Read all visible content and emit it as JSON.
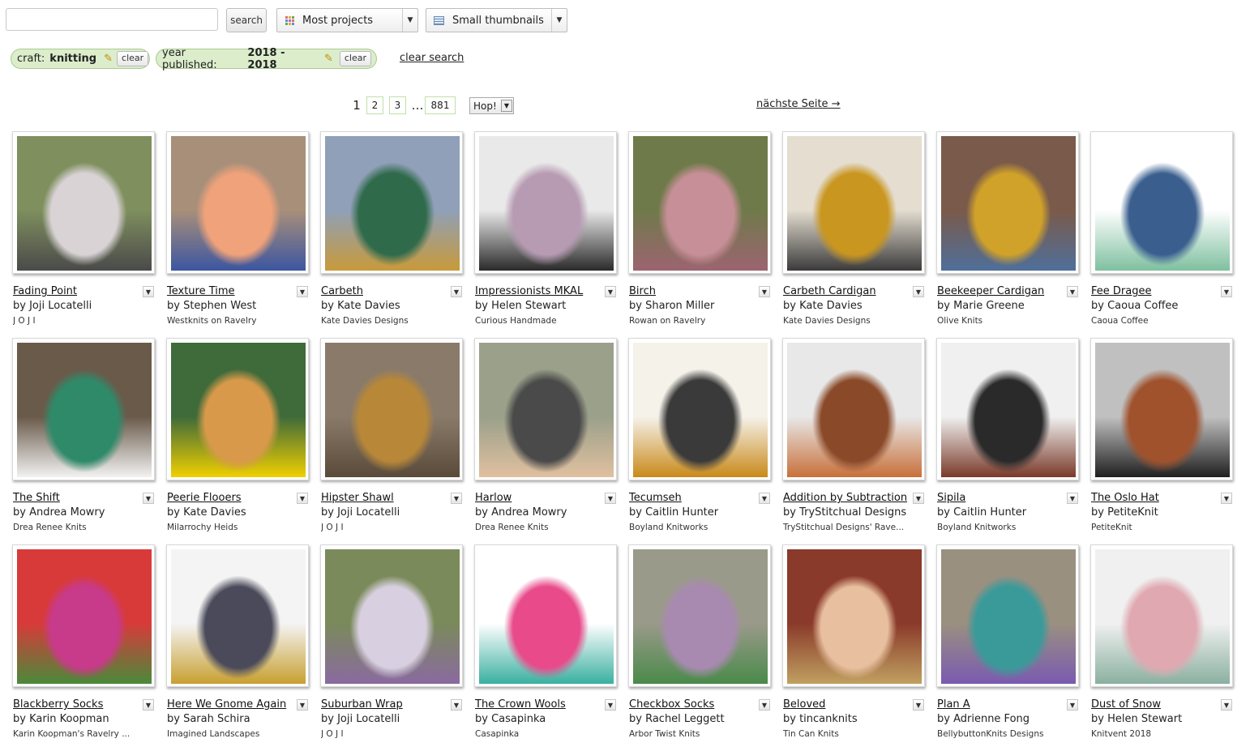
{
  "search": {
    "value": "",
    "button_label": "search"
  },
  "sort_dropdown": {
    "selected": "Most projects"
  },
  "view_dropdown": {
    "selected": "Small thumbnails"
  },
  "filters": [
    {
      "label": "craft:",
      "value": "knitting",
      "clear_label": "clear"
    },
    {
      "label": "year published:",
      "value": "2018 - 2018",
      "clear_label": "clear"
    }
  ],
  "clear_search_label": "clear search",
  "pagination": {
    "current": "1",
    "pages": [
      "2",
      "3"
    ],
    "ellipsis": "…",
    "last": "881",
    "hop_label": "Hop!",
    "next_label": "nächste Seite →"
  },
  "patterns": [
    {
      "name": "Fading Point",
      "author": "by Joji Locatelli",
      "source": "J O J I"
    },
    {
      "name": "Texture Time",
      "author": "by Stephen West",
      "source": "Westknits on Ravelry"
    },
    {
      "name": "Carbeth",
      "author": "by Kate Davies",
      "source": "Kate Davies Designs"
    },
    {
      "name": "Impressionists MKAL",
      "author": "by Helen Stewart",
      "source": "Curious Handmade"
    },
    {
      "name": "Birch",
      "author": "by Sharon Miller",
      "source": "Rowan on Ravelry"
    },
    {
      "name": "Carbeth Cardigan",
      "author": "by Kate Davies",
      "source": "Kate Davies Designs"
    },
    {
      "name": "Beekeeper Cardigan",
      "author": "by Marie Greene",
      "source": "Olive Knits"
    },
    {
      "name": "Fee Dragee",
      "author": "by Caoua Coffee",
      "source": "Caoua Coffee"
    },
    {
      "name": "The Shift",
      "author": "by Andrea Mowry",
      "source": "Drea Renee Knits"
    },
    {
      "name": "Peerie Flooers",
      "author": "by Kate Davies",
      "source": "Milarrochy Heids"
    },
    {
      "name": "Hipster Shawl",
      "author": "by Joji Locatelli",
      "source": "J O J I"
    },
    {
      "name": "Harlow",
      "author": "by Andrea Mowry",
      "source": "Drea Renee Knits"
    },
    {
      "name": "Tecumseh",
      "author": "by Caitlin Hunter",
      "source": "Boyland Knitworks"
    },
    {
      "name": "Addition by Subtraction",
      "author": "by TryStitchual Designs",
      "source": "TryStitchual Designs' Rave..."
    },
    {
      "name": "Sipila",
      "author": "by Caitlin Hunter",
      "source": "Boyland Knitworks"
    },
    {
      "name": "The Oslo Hat",
      "author": "by PetiteKnit",
      "source": "PetiteKnit"
    },
    {
      "name": "Blackberry Socks",
      "author": "by Karin Koopman",
      "source": "Karin Koopman's Ravelry ..."
    },
    {
      "name": "Here We Gnome Again",
      "author": "by Sarah Schira",
      "source": "Imagined Landscapes"
    },
    {
      "name": "Suburban Wrap",
      "author": "by Joji Locatelli",
      "source": "J O J I"
    },
    {
      "name": "The Crown Wools",
      "author": "by Casapinka",
      "source": "Casapinka"
    },
    {
      "name": "Checkbox Socks",
      "author": "by Rachel Leggett",
      "source": "Arbor Twist Knits"
    },
    {
      "name": "Beloved",
      "author": "by tincanknits",
      "source": "Tin Can Knits"
    },
    {
      "name": "Plan A",
      "author": "by Adrienne Fong",
      "source": "BellybuttonKnits Designs"
    },
    {
      "name": "Dust of Snow",
      "author": "by Helen Stewart",
      "source": "Knitvent 2018"
    }
  ],
  "thumb_colors": [
    [
      "#7f8f5e",
      "#d9d3d6",
      "#4a4a4a"
    ],
    [
      "#a88f7a",
      "#f0a27a",
      "#3d56a0"
    ],
    [
      "#8fa0b8",
      "#2f6a4a",
      "#c89a3a"
    ],
    [
      "#e9e9e9",
      "#b79bb3",
      "#2a2a2a"
    ],
    [
      "#6f7a4a",
      "#c78f97",
      "#9c6470"
    ],
    [
      "#e4ddd0",
      "#c9961f",
      "#3b3b3b"
    ],
    [
      "#7a5a4a",
      "#d0a22a",
      "#4f6f9a"
    ],
    [
      "#ffffff",
      "#3a5f8f",
      "#7fc0a0"
    ],
    [
      "#6a5a4a",
      "#2f8a6a",
      "#f2f2f2"
    ],
    [
      "#3f6a3a",
      "#d89a4a",
      "#f0d000"
    ],
    [
      "#8a7a6a",
      "#b88838",
      "#5a4a3a"
    ],
    [
      "#9aa08a",
      "#4a4a4a",
      "#e0c0a0"
    ],
    [
      "#f5f2ea",
      "#3a3a3a",
      "#c98a1a"
    ],
    [
      "#e8e8e8",
      "#8a4a2a",
      "#c8703a"
    ],
    [
      "#f0f0f0",
      "#2a2a2a",
      "#7a3a2a"
    ],
    [
      "#c0c0c0",
      "#a0522d",
      "#202020"
    ],
    [
      "#d83a3a",
      "#c83a8a",
      "#4a8a3a"
    ],
    [
      "#f4f4f4",
      "#4a4a5a",
      "#c8a030"
    ],
    [
      "#7a8a5a",
      "#d8d0e0",
      "#8a6aa0"
    ],
    [
      "#ffffff",
      "#e84a8a",
      "#3ab0a0"
    ],
    [
      "#9a9a8a",
      "#a88ab0",
      "#4a8a4a"
    ],
    [
      "#8a3a2a",
      "#e8c0a0",
      "#c0a060"
    ],
    [
      "#9a9080",
      "#3a9a9a",
      "#7a5ab0"
    ],
    [
      "#f0f0f0",
      "#e0a8b0",
      "#8ab0a0"
    ]
  ]
}
